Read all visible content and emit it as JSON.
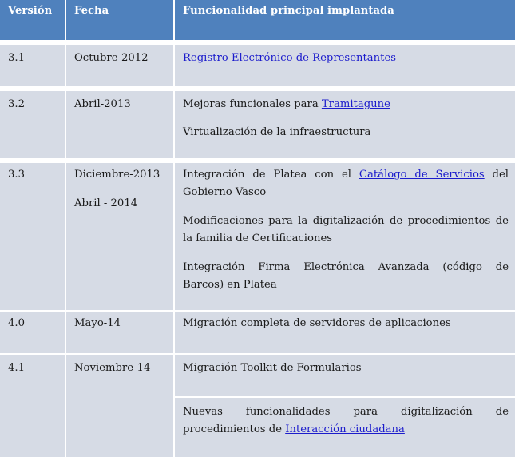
{
  "header": {
    "version": "Versión",
    "date": "Fecha",
    "feature": "Funcionalidad principal implantada"
  },
  "rows": [
    {
      "version": "3.1",
      "dates": [
        "Octubre-2012"
      ],
      "items": [
        {
          "pre": "",
          "link": "Registro Electrónico de Representantes",
          "post": ""
        }
      ]
    },
    {
      "version": "3.2",
      "dates": [
        "Abril-2013"
      ],
      "items": [
        {
          "pre": "Mejoras funcionales para ",
          "link": "Tramitagune",
          "post": ""
        },
        {
          "pre": "Virtualización de la infraestructura",
          "link": "",
          "post": ""
        }
      ]
    },
    {
      "version": "3.3",
      "dates": [
        "Diciembre-2013",
        "Abril - 2014"
      ],
      "items": [
        {
          "line1_pre": "Integración de Platea con el ",
          "line1_link": "Catálogo de Servicios",
          "line1_post": " del",
          "line2": "Gobierno Vasco"
        },
        {
          "line1": "Modificaciones para la digitalización de procedimientos de",
          "line2": "la familia de Certificaciones"
        },
        {
          "line1": "Integración Firma Electrónica Avanzada (código de",
          "line2": "Barcos) en Platea"
        }
      ]
    },
    {
      "version": "4.0",
      "dates": [
        "Mayo-14"
      ],
      "items": [
        {
          "pre": "Migración completa de servidores de aplicaciones",
          "link": "",
          "post": ""
        }
      ]
    },
    {
      "version": "4.1",
      "dates": [
        "Noviembre-14"
      ],
      "items": [
        {
          "pre": "Migración Toolkit de Formularios",
          "link": "",
          "post": ""
        },
        {
          "line1": "Nuevas funcionalidades para digitalización de",
          "line2_pre": "procedimientos de ",
          "line2_link": "Interacción ciudadana"
        }
      ]
    }
  ]
}
